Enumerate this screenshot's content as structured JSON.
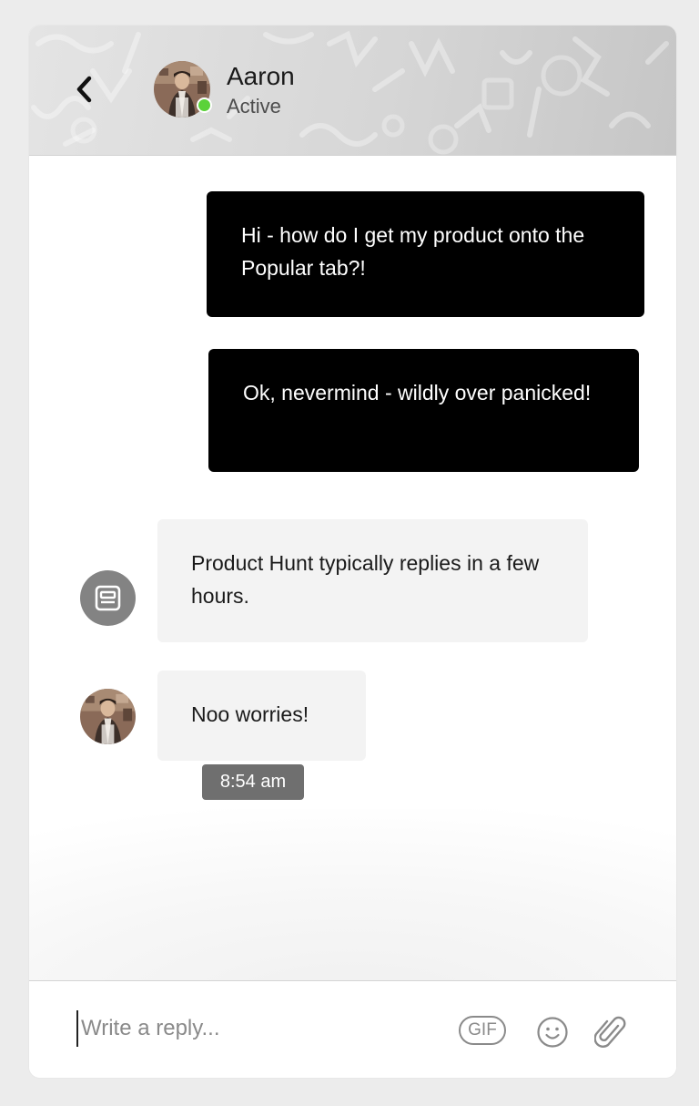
{
  "header": {
    "contact_name": "Aaron",
    "contact_status": "Active",
    "online_color": "#5bd23a",
    "back_icon": "chevron-left-icon"
  },
  "messages": [
    {
      "direction": "outgoing",
      "text": "Hi - how do I get my product onto the Popular tab?!"
    },
    {
      "direction": "outgoing",
      "text": "Ok, nevermind - wildly over panicked!"
    },
    {
      "direction": "incoming",
      "sender": "bot",
      "text": "Product Hunt typically replies in a few hours."
    },
    {
      "direction": "incoming",
      "sender": "Aaron",
      "text": "Noo worries!",
      "timestamp": "8:54 am"
    }
  ],
  "composer": {
    "placeholder": "Write a reply...",
    "gif_label": "GIF",
    "emoji_icon": "smiley-icon",
    "attach_icon": "paperclip-icon"
  },
  "colors": {
    "outgoing_bubble": "#000000",
    "incoming_bubble": "#f3f3f3",
    "timestamp_badge": "#6f6f6f"
  }
}
